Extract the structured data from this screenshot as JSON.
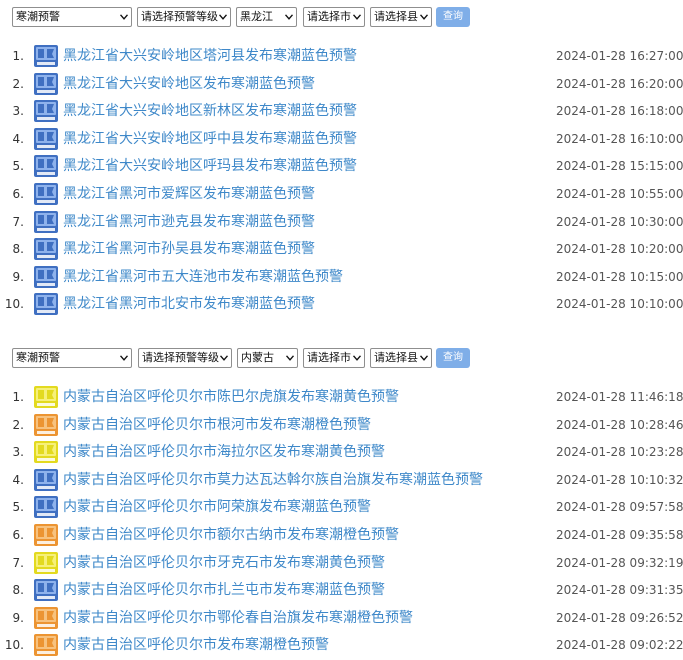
{
  "panels": [
    {
      "filters": {
        "type_select": "寒潮预警",
        "level_select": "请选择预警等级",
        "province_select": "黑龙江",
        "city_select": "请选择市",
        "county_select": "请选择县",
        "query_label": "查询"
      },
      "items": [
        {
          "num": "1.",
          "title": "黑龙江省大兴安岭地区塔河县发布寒潮蓝色预警",
          "time": "2024-01-28 16:27:00",
          "level": "blue"
        },
        {
          "num": "2.",
          "title": "黑龙江省大兴安岭地区发布寒潮蓝色预警",
          "time": "2024-01-28 16:20:00",
          "level": "blue"
        },
        {
          "num": "3.",
          "title": "黑龙江省大兴安岭地区新林区发布寒潮蓝色预警",
          "time": "2024-01-28 16:18:00",
          "level": "blue"
        },
        {
          "num": "4.",
          "title": "黑龙江省大兴安岭地区呼中县发布寒潮蓝色预警",
          "time": "2024-01-28 16:10:00",
          "level": "blue"
        },
        {
          "num": "5.",
          "title": "黑龙江省大兴安岭地区呼玛县发布寒潮蓝色预警",
          "time": "2024-01-28 15:15:00",
          "level": "blue"
        },
        {
          "num": "6.",
          "title": "黑龙江省黑河市爱辉区发布寒潮蓝色预警",
          "time": "2024-01-28 10:55:00",
          "level": "blue"
        },
        {
          "num": "7.",
          "title": "黑龙江省黑河市逊克县发布寒潮蓝色预警",
          "time": "2024-01-28 10:30:00",
          "level": "blue"
        },
        {
          "num": "8.",
          "title": "黑龙江省黑河市孙吴县发布寒潮蓝色预警",
          "time": "2024-01-28 10:20:00",
          "level": "blue"
        },
        {
          "num": "9.",
          "title": "黑龙江省黑河市五大连池市发布寒潮蓝色预警",
          "time": "2024-01-28 10:15:00",
          "level": "blue"
        },
        {
          "num": "10.",
          "title": "黑龙江省黑河市北安市发布寒潮蓝色预警",
          "time": "2024-01-28 10:10:00",
          "level": "blue"
        }
      ]
    },
    {
      "filters": {
        "type_select": "寒潮预警",
        "level_select": "请选择预警等级",
        "province_select": "内蒙古",
        "city_select": "请选择市",
        "county_select": "请选择县",
        "query_label": "查询"
      },
      "items": [
        {
          "num": "1.",
          "title": "内蒙古自治区呼伦贝尔市陈巴尔虎旗发布寒潮黄色预警",
          "time": "2024-01-28 11:46:18",
          "level": "yellow"
        },
        {
          "num": "2.",
          "title": "内蒙古自治区呼伦贝尔市根河市发布寒潮橙色预警",
          "time": "2024-01-28 10:28:46",
          "level": "orange"
        },
        {
          "num": "3.",
          "title": "内蒙古自治区呼伦贝尔市海拉尔区发布寒潮黄色预警",
          "time": "2024-01-28 10:23:28",
          "level": "yellow"
        },
        {
          "num": "4.",
          "title": "内蒙古自治区呼伦贝尔市莫力达瓦达斡尔族自治旗发布寒潮蓝色预警",
          "time": "2024-01-28 10:10:32",
          "level": "blue"
        },
        {
          "num": "5.",
          "title": "内蒙古自治区呼伦贝尔市阿荣旗发布寒潮蓝色预警",
          "time": "2024-01-28 09:57:58",
          "level": "blue"
        },
        {
          "num": "6.",
          "title": "内蒙古自治区呼伦贝尔市额尔古纳市发布寒潮橙色预警",
          "time": "2024-01-28 09:35:58",
          "level": "orange"
        },
        {
          "num": "7.",
          "title": "内蒙古自治区呼伦贝尔市牙克石市发布寒潮黄色预警",
          "time": "2024-01-28 09:32:19",
          "level": "yellow"
        },
        {
          "num": "8.",
          "title": "内蒙古自治区呼伦贝尔市扎兰屯市发布寒潮蓝色预警",
          "time": "2024-01-28 09:31:35",
          "level": "blue"
        },
        {
          "num": "9.",
          "title": "内蒙古自治区呼伦贝尔市鄂伦春自治旗发布寒潮橙色预警",
          "time": "2024-01-28 09:26:52",
          "level": "orange"
        },
        {
          "num": "10.",
          "title": "内蒙古自治区呼伦贝尔市发布寒潮橙色预警",
          "time": "2024-01-28 09:02:22",
          "level": "orange"
        }
      ]
    }
  ],
  "level_colors": {
    "blue": {
      "bg": "#3f6fc1",
      "inner": "#8eb2ec",
      "icon": "cold-wave-blue-warning-icon"
    },
    "yellow": {
      "bg": "#e3da1f",
      "inner": "#f6f07a",
      "icon": "cold-wave-yellow-warning-icon"
    },
    "orange": {
      "bg": "#ec9432",
      "inner": "#f7c27f",
      "icon": "cold-wave-orange-warning-icon"
    }
  },
  "link_color": "#3e88c9",
  "query_button_color": "#7faee8"
}
